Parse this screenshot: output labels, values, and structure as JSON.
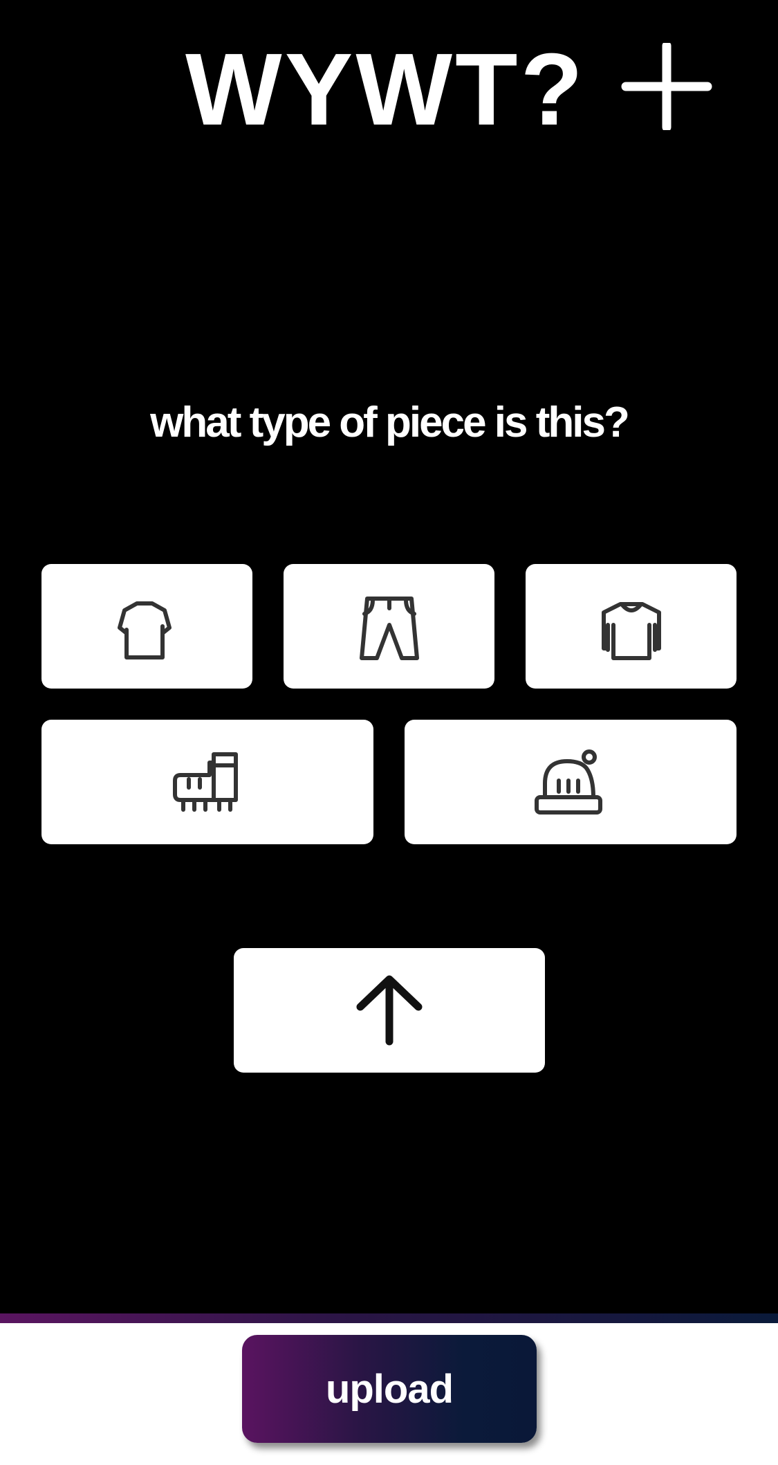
{
  "header": {
    "title": "WYWT?",
    "add_icon": "plus-icon"
  },
  "prompt": {
    "question": "what type of piece is this?"
  },
  "piece_types": [
    {
      "icon": "tshirt-icon"
    },
    {
      "icon": "pants-icon"
    },
    {
      "icon": "long-sleeve-shirt-icon"
    },
    {
      "icon": "shoe-icon"
    },
    {
      "icon": "beanie-icon"
    }
  ],
  "actions": {
    "upload_arrow_icon": "arrow-up-icon",
    "upload_label": "upload"
  },
  "colors": {
    "background": "#000000",
    "tile": "#ffffff",
    "icon_stroke": "#333333",
    "gradient_start": "#5a1460",
    "gradient_end": "#0a1838"
  }
}
